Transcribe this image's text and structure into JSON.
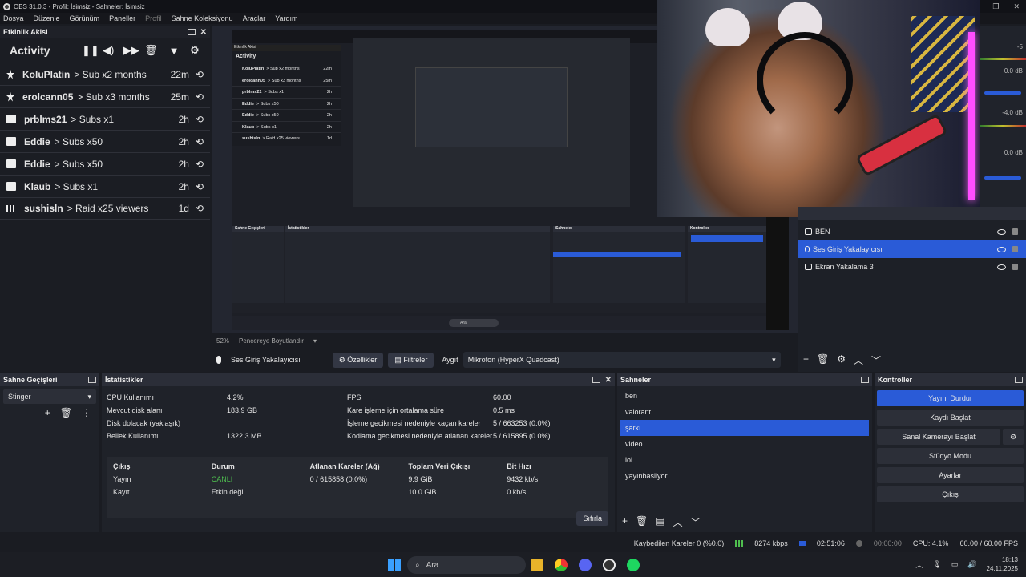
{
  "window": {
    "title": "OBS 31.0.3 - Profil: İsimsiz - Sahneler: İsimsiz"
  },
  "menu": [
    "Dosya",
    "Düzenle",
    "Görünüm",
    "Paneller",
    "Profil",
    "Sahne Koleksiyonu",
    "Araçlar",
    "Yardım"
  ],
  "activity": {
    "panel_title": "Etkinlik Akisi",
    "title": "Activity",
    "rows": [
      {
        "user": "KoluPlatin",
        "desc": "> Sub x2 months",
        "time": "22m",
        "kind": "star"
      },
      {
        "user": "erolcann05",
        "desc": "> Sub x3 months",
        "time": "25m",
        "kind": "star"
      },
      {
        "user": "prblms21",
        "desc": "> Subs x1",
        "time": "2h",
        "kind": "gift"
      },
      {
        "user": "Eddie",
        "desc": "> Subs x50",
        "time": "2h",
        "kind": "gift"
      },
      {
        "user": "Eddie",
        "desc": "> Subs x50",
        "time": "2h",
        "kind": "gift"
      },
      {
        "user": "Klaub",
        "desc": "> Subs x1",
        "time": "2h",
        "kind": "gift"
      },
      {
        "user": "sushisln",
        "desc": "> Raid x25 viewers",
        "time": "1d",
        "kind": "raid"
      }
    ]
  },
  "preview": {
    "zoom": "52%",
    "fit_label": "Pencereye Boyutlandır",
    "mini_search": "Ara"
  },
  "mixer_peek": {
    "values": [
      "-5",
      "0.0 dB",
      "-4.0 dB",
      "0.0 dB"
    ]
  },
  "source_bar": {
    "source_name": "Ses Giriş Yakalayıcısı",
    "properties": "Özellikler",
    "filters": "Filtreler",
    "device_label": "Aygıt",
    "device_value": "Mikrofon (HyperX Quadcast)"
  },
  "sources": {
    "items": [
      {
        "name": "BEN",
        "selected": false
      },
      {
        "name": "Ses Giriş Yakalayıcısı",
        "selected": true
      },
      {
        "name": "Ekran Yakalama 3",
        "selected": false
      }
    ]
  },
  "scene_transitions": {
    "title": "Sahne Geçişleri",
    "value": "Stinger"
  },
  "stats": {
    "title": "İstatistikler",
    "rows": [
      {
        "k1": "CPU Kullanımı",
        "v1": "4.2%",
        "k2": "FPS",
        "v2": "60.00"
      },
      {
        "k1": "Mevcut disk alanı",
        "v1": "183.9 GB",
        "k2": "Kare işleme için ortalama süre",
        "v2": "0.5 ms"
      },
      {
        "k1": "Disk dolacak (yaklaşık)",
        "v1": "",
        "k2": "İşleme gecikmesi nedeniyle kaçan kareler",
        "v2": "5 / 663253 (0.0%)"
      },
      {
        "k1": "Bellek Kullanımı",
        "v1": "1322.3 MB",
        "k2": "Kodlama gecikmesi nedeniyle atlanan kareler",
        "v2": "5 / 615895 (0.0%)"
      }
    ],
    "output_headers": [
      "Çıkış",
      "Durum",
      "Atlanan Kareler (Ağ)",
      "Toplam Veri Çıkışı",
      "Bit Hızı"
    ],
    "outputs": [
      {
        "name": "Yayın",
        "status": "CANLI",
        "dropped": "0 / 615858 (0.0%)",
        "total": "9.9 GiB",
        "bitrate": "9432 kb/s"
      },
      {
        "name": "Kayıt",
        "status": "Etkin değil",
        "dropped": "",
        "total": "10.0 GiB",
        "bitrate": "0 kb/s"
      }
    ],
    "reset": "Sıfırla"
  },
  "scenes": {
    "title": "Sahneler",
    "items": [
      {
        "name": "ben",
        "selected": false
      },
      {
        "name": "valorant",
        "selected": false
      },
      {
        "name": "şarkı",
        "selected": true
      },
      {
        "name": "video",
        "selected": false
      },
      {
        "name": "lol",
        "selected": false
      },
      {
        "name": "yayınbasliyor",
        "selected": false
      }
    ]
  },
  "controls": {
    "title": "Kontroller",
    "stop_stream": "Yayını Durdur",
    "start_record": "Kaydı Başlat",
    "virtual_cam": "Sanal Kamerayı Başlat",
    "studio_mode": "Stüdyo Modu",
    "settings": "Ayarlar",
    "exit": "Çıkış"
  },
  "status": {
    "dropped": "Kaybedilen Kareler 0 (%0.0)",
    "kbps": "8274 kbps",
    "stream_time": "02:51:06",
    "rec_time": "00:00:00",
    "cpu": "CPU: 4.1%",
    "fps": "60.00 / 60.00 FPS"
  },
  "taskbar": {
    "search": "Ara",
    "time": "18:13",
    "date": "24.11.2025"
  }
}
